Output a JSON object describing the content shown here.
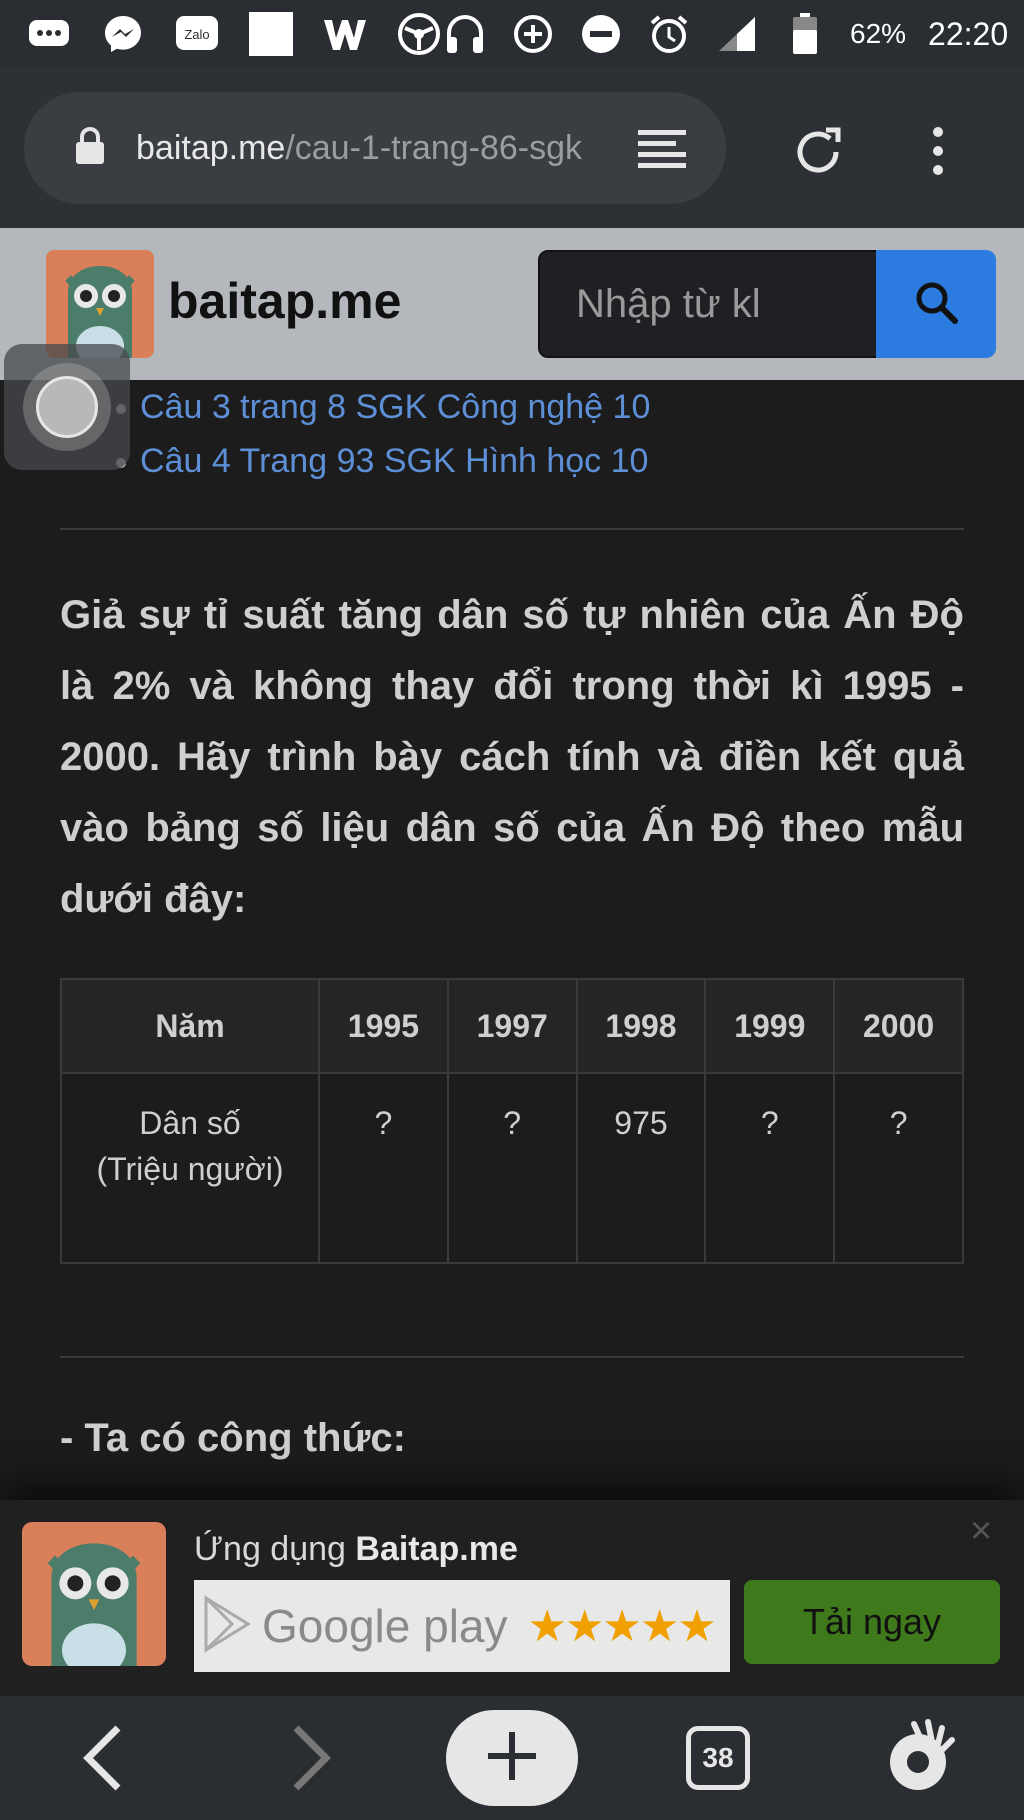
{
  "status_bar": {
    "icons": [
      "chat-bubble-icon",
      "messenger-icon",
      "zalo-icon",
      "blank-notification-icon",
      "w-app-icon",
      "steering-icon",
      "headphones-icon",
      "data-saver-icon",
      "do-not-disturb-icon",
      "alarm-icon",
      "signal-icon",
      "battery-icon"
    ],
    "zalo_label": "Zalo",
    "battery": "62%",
    "time": "22:20"
  },
  "browser": {
    "url_domain": "baitap.me",
    "url_path": "/cau-1-trang-86-sgk"
  },
  "site": {
    "brand": "baitap.me",
    "search_placeholder": "Nhập từ kl"
  },
  "related_links": [
    "Câu 3 trang 8 SGK Công nghệ 10",
    "Câu 4 Trang 93 SGK Hình học 10"
  ],
  "question": "Giả sự tỉ suất tăng dân số tự nhiên của Ấn Độ là 2% và không thay đổi trong thời kì 1995 - 2000. Hãy trình bày cách tính và điền kết quả vào bảng số liệu dân số của Ấn Độ theo mẫu dưới đây:",
  "table": {
    "header_label": "Năm",
    "years": [
      "1995",
      "1997",
      "1998",
      "1999",
      "2000"
    ],
    "row_label_line1": "Dân số",
    "row_label_line2": "(Triệu người)",
    "values": [
      "?",
      "?",
      "975",
      "?",
      "?"
    ]
  },
  "formula_heading": "- Ta có công thức:",
  "app_banner": {
    "title_prefix": "Ứng dụng ",
    "title_brand": "Baitap.me",
    "store_label": "Google play",
    "stars": "★★★★★",
    "install_label": "Tải ngay",
    "close": "×"
  },
  "bottom_nav": {
    "tab_count": "38"
  },
  "colors": {
    "link": "#5d8fd6",
    "search_button": "#2b7be0",
    "install_button": "#3e7a1c",
    "star": "#f0a000",
    "logo_bg": "#d9805a"
  }
}
